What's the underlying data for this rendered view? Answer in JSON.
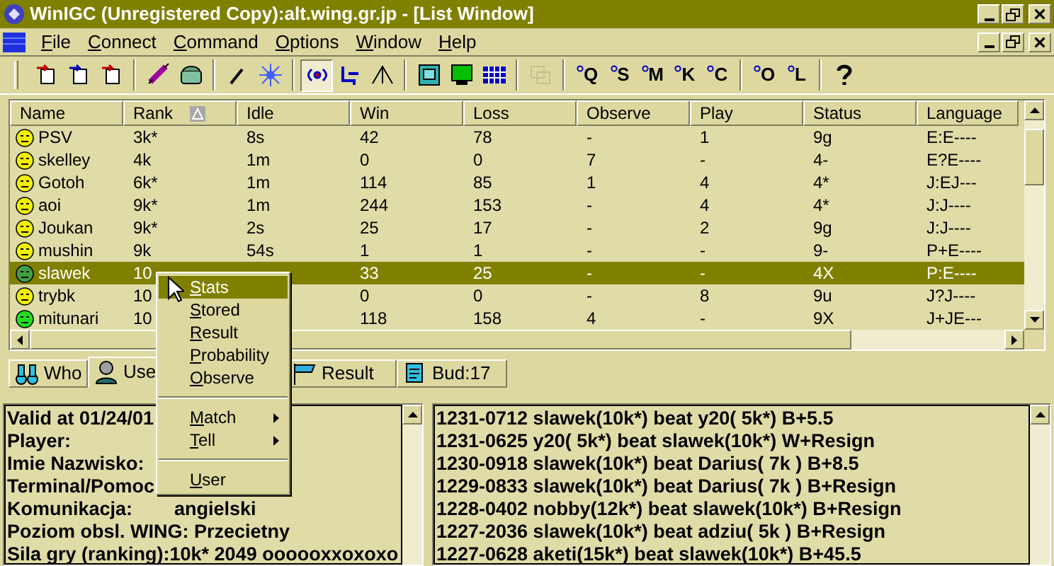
{
  "window": {
    "title": "WinIGC (Unregistered Copy):alt.wing.gr.jp - [List Window]"
  },
  "menu": [
    "File",
    "Connect",
    "Command",
    "Options",
    "Window",
    "Help"
  ],
  "toolbar": [
    {
      "kind": "icon",
      "pressed": false,
      "disabled": false
    },
    {
      "kind": "icon",
      "pressed": false,
      "disabled": false
    },
    {
      "kind": "icon",
      "pressed": false,
      "disabled": false
    },
    {
      "kind": "separator"
    },
    {
      "kind": "icon",
      "pressed": false,
      "disabled": false
    },
    {
      "kind": "icon",
      "pressed": false,
      "disabled": false
    },
    {
      "kind": "separator"
    },
    {
      "kind": "icon",
      "pressed": false,
      "disabled": false
    },
    {
      "kind": "icon",
      "pressed": false,
      "disabled": false
    },
    {
      "kind": "separator"
    },
    {
      "kind": "icon",
      "pressed": true,
      "disabled": false
    },
    {
      "kind": "icon",
      "pressed": false,
      "disabled": false
    },
    {
      "kind": "icon",
      "pressed": false,
      "disabled": false
    },
    {
      "kind": "separator"
    },
    {
      "kind": "icon",
      "pressed": false,
      "disabled": false
    },
    {
      "kind": "icon",
      "pressed": false,
      "disabled": false
    },
    {
      "kind": "icon",
      "pressed": false,
      "disabled": false
    },
    {
      "kind": "separator"
    },
    {
      "kind": "icon",
      "pressed": false,
      "disabled": true
    },
    {
      "kind": "separator"
    },
    {
      "kind": "letter",
      "label": "Q"
    },
    {
      "kind": "letter",
      "label": "S"
    },
    {
      "kind": "letter",
      "label": "M"
    },
    {
      "kind": "letter",
      "label": "K"
    },
    {
      "kind": "letter",
      "label": "C"
    },
    {
      "kind": "separator"
    },
    {
      "kind": "letter",
      "label": "O"
    },
    {
      "kind": "letter",
      "label": "L"
    },
    {
      "kind": "separator"
    },
    {
      "kind": "icon",
      "pressed": false,
      "disabled": false
    }
  ],
  "table": {
    "columns": [
      {
        "label": "Name",
        "sorted": false
      },
      {
        "label": "Rank",
        "sorted": true
      },
      {
        "label": "Idle",
        "sorted": false
      },
      {
        "label": "Win",
        "sorted": false
      },
      {
        "label": "Loss",
        "sorted": false
      },
      {
        "label": "Observe",
        "sorted": false
      },
      {
        "label": "Play",
        "sorted": false
      },
      {
        "label": "Status",
        "sorted": false
      },
      {
        "label": "Language",
        "sorted": false
      }
    ],
    "rows": [
      {
        "color": "#f0f000",
        "selected": false,
        "cells": [
          "PSV",
          "3k*",
          "8s",
          "42",
          "78",
          "-",
          "1",
          "9g",
          "E:E----"
        ]
      },
      {
        "color": "#f0f000",
        "selected": false,
        "cells": [
          "skelley",
          "4k",
          "1m",
          "0",
          "0",
          "7",
          "-",
          "4-",
          "E?E----"
        ]
      },
      {
        "color": "#f0f000",
        "selected": false,
        "cells": [
          "Gotoh",
          "6k*",
          "1m",
          "114",
          "85",
          "1",
          "4",
          "4*",
          "J:EJ---"
        ]
      },
      {
        "color": "#f0f000",
        "selected": false,
        "cells": [
          "aoi",
          "9k*",
          "1m",
          "244",
          "153",
          "-",
          "4",
          "4*",
          "J:J----"
        ]
      },
      {
        "color": "#f0f000",
        "selected": false,
        "cells": [
          "Joukan",
          "9k*",
          "2s",
          "25",
          "17",
          "-",
          "2",
          "9g",
          "J:J----"
        ]
      },
      {
        "color": "#f0f000",
        "selected": false,
        "cells": [
          "mushin",
          "9k",
          "54s",
          "1",
          "1",
          "-",
          "-",
          "9-",
          "P+E----"
        ]
      },
      {
        "color": "#40a040",
        "selected": true,
        "cells": [
          "slawek",
          "10",
          null,
          "33",
          "25",
          "-",
          "-",
          "4X",
          "P:E----"
        ]
      },
      {
        "color": "#f0f000",
        "selected": false,
        "cells": [
          "trybk",
          "10",
          null,
          "0",
          "0",
          "-",
          "8",
          "9u",
          "J?J----"
        ]
      },
      {
        "color": "#20e020",
        "selected": false,
        "cells": [
          "mitunari",
          "10",
          null,
          "118",
          "158",
          "4",
          "-",
          "9X",
          "J+JE---"
        ]
      }
    ]
  },
  "tabs": [
    {
      "label": "Who",
      "selected": false
    },
    {
      "label": "Use",
      "selected": true
    },
    {
      "label": "Result",
      "selected": false
    },
    {
      "label": "Bud:17",
      "selected": false
    }
  ],
  "user_info": [
    {
      "label": "Valid at 01/24/01"
    },
    {
      "label": "Player:"
    },
    {
      "label": "Imie Nazwisko:"
    },
    {
      "label": "Terminal/Pomoc"
    },
    {
      "label": "Komunikacja:",
      "value": "angielski"
    },
    {
      "label": "Poziom obsl. WING:  Przecietny"
    },
    {
      "label": "Sila gry (ranking):10k*   2049 oooooxxoxoxo"
    }
  ],
  "results": [
    "1231-0712 slawek(10k*) beat y20( 5k*) B+5.5",
    "1231-0625 y20( 5k*) beat slawek(10k*) W+Resign",
    "1230-0918 slawek(10k*) beat Darius( 7k ) B+8.5",
    "1229-0833 slawek(10k*) beat Darius( 7k ) B+Resign",
    "1228-0402 nobby(12k*) beat slawek(10k*) B+Resign",
    "1227-2036 slawek(10k*) beat adziu( 5k ) B+Resign",
    "1227-0628 aketi(15k*) beat slawek(10k*) B+45.5"
  ],
  "context_menu": [
    {
      "kind": "item",
      "label": "Stats",
      "selected": true
    },
    {
      "kind": "item",
      "label": "Stored",
      "selected": false
    },
    {
      "kind": "item",
      "label": "Result",
      "selected": false
    },
    {
      "kind": "item",
      "label": "Probability",
      "selected": false
    },
    {
      "kind": "item",
      "label": "Observe",
      "selected": false
    },
    {
      "kind": "separator"
    },
    {
      "kind": "submenu",
      "label": "Match",
      "selected": false
    },
    {
      "kind": "submenu",
      "label": "Tell",
      "selected": false
    },
    {
      "kind": "separator"
    },
    {
      "kind": "item",
      "label": "User",
      "selected": false
    }
  ]
}
